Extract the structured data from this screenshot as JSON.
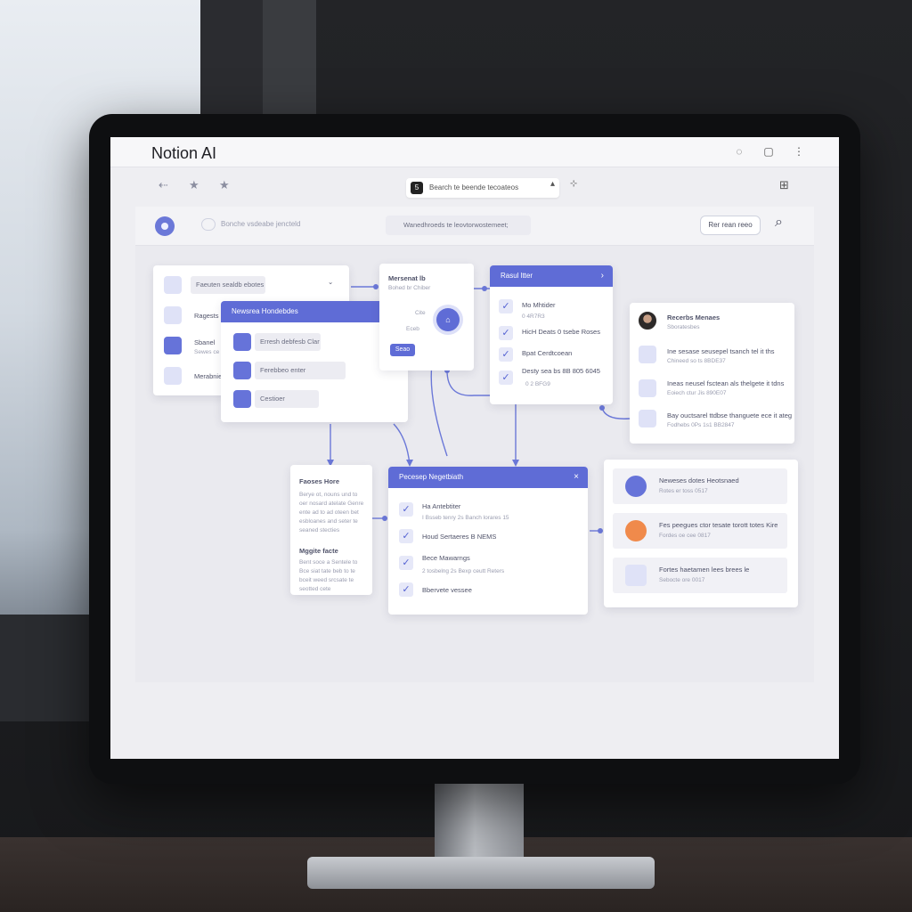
{
  "app": {
    "title": "Notion AI"
  },
  "toolbar": {
    "url_text": "Bearch te beende tecoateos",
    "url_badge": "5"
  },
  "canvas_header": {
    "placeholder": "Bonche vsdeabe jencteld",
    "search_text": "Wanedhroeds te leovtorwostemeet;",
    "action_button": "Rer rean reeo"
  },
  "cards": {
    "left_menu": {
      "items": [
        "Faeuten sealdb ebotes",
        "Ragests",
        "Sbanel",
        "Merabnie"
      ],
      "sub": "Sewes ce ess"
    },
    "overlay": {
      "header": "Newsrea Hondebdes",
      "items": [
        "Erresh debfesb Clar",
        "Ferebbeo enter",
        "Cestioer"
      ]
    },
    "mid_top": {
      "title": "Mersenat lb",
      "sub": "Bohed br Chiber",
      "chip1": "Cite",
      "chip2": "Eceb",
      "button": "Seao"
    },
    "right_list": {
      "header": "Rasul ltter",
      "items": [
        {
          "text": "Mo Mhtider",
          "sub": "0 4R7R3"
        },
        {
          "text": "HicH Deats 0 tsebe Roses",
          "sub": ""
        },
        {
          "text": "Bpat Cerdtcoean",
          "sub": ""
        },
        {
          "text": "Desty sea bs 8B 805 6045",
          "sub": "0 2 BFG9"
        }
      ]
    },
    "people": {
      "name": "Recerbs Menaes",
      "sub": "Sboratesbes",
      "items": [
        {
          "text": "Ine sesase seusepel tsanch tel it ths",
          "sub": "Chineed so ts 8BDE37"
        },
        {
          "text": "Ineas neusel fsctean als thelgete it tdns",
          "sub": "Eoiech ctur Jis 890E07"
        },
        {
          "text": "Bay ouctsarel ttdbse thanguete ece it ateg",
          "sub": "Fodhebs 0Ps 1s1 BB2847"
        }
      ]
    },
    "notes": {
      "title1": "Faoses Hore",
      "body1": [
        "Berye ot, nouns und to",
        "oer nosard atelate Genre",
        "ente ad to ad oteen bet",
        "esbloanes and seter te",
        "seaned stecties"
      ],
      "title2": "Mggite facte",
      "body2": [
        "Bent soce a Sentele to",
        "Bce siat tate beb to te",
        "bceit weed srcsate te",
        "seotted cete"
      ]
    },
    "tasks": {
      "header": "Pecesep Negetbiath",
      "items": [
        {
          "text": "Ha Antebtiter",
          "sub": "I Bsseb tenry 2s Banch lorares 15"
        },
        {
          "text": "Houd Sertaeres B NEMS",
          "sub": ""
        },
        {
          "text": "Bece Mawarngs",
          "sub": "2 tosbelng 2s Bexp ceutt Reters"
        },
        {
          "text": "Bbervete vessee",
          "sub": ""
        }
      ]
    },
    "activity": {
      "items": [
        {
          "text": "Neweses dotes Heotsnaed",
          "sub": "Rotes er toss 0517"
        },
        {
          "text": "Fes peegues ctor tesate torott totes Kire",
          "sub": "Fordes oe cee 0817"
        },
        {
          "text": "Fortes haetamen lees brees le",
          "sub": "Sebocte ore 0017"
        }
      ]
    }
  },
  "colors": {
    "accent": "#5f6cd6",
    "orange": "#f08a4b",
    "canvas": "#eaeaef"
  }
}
